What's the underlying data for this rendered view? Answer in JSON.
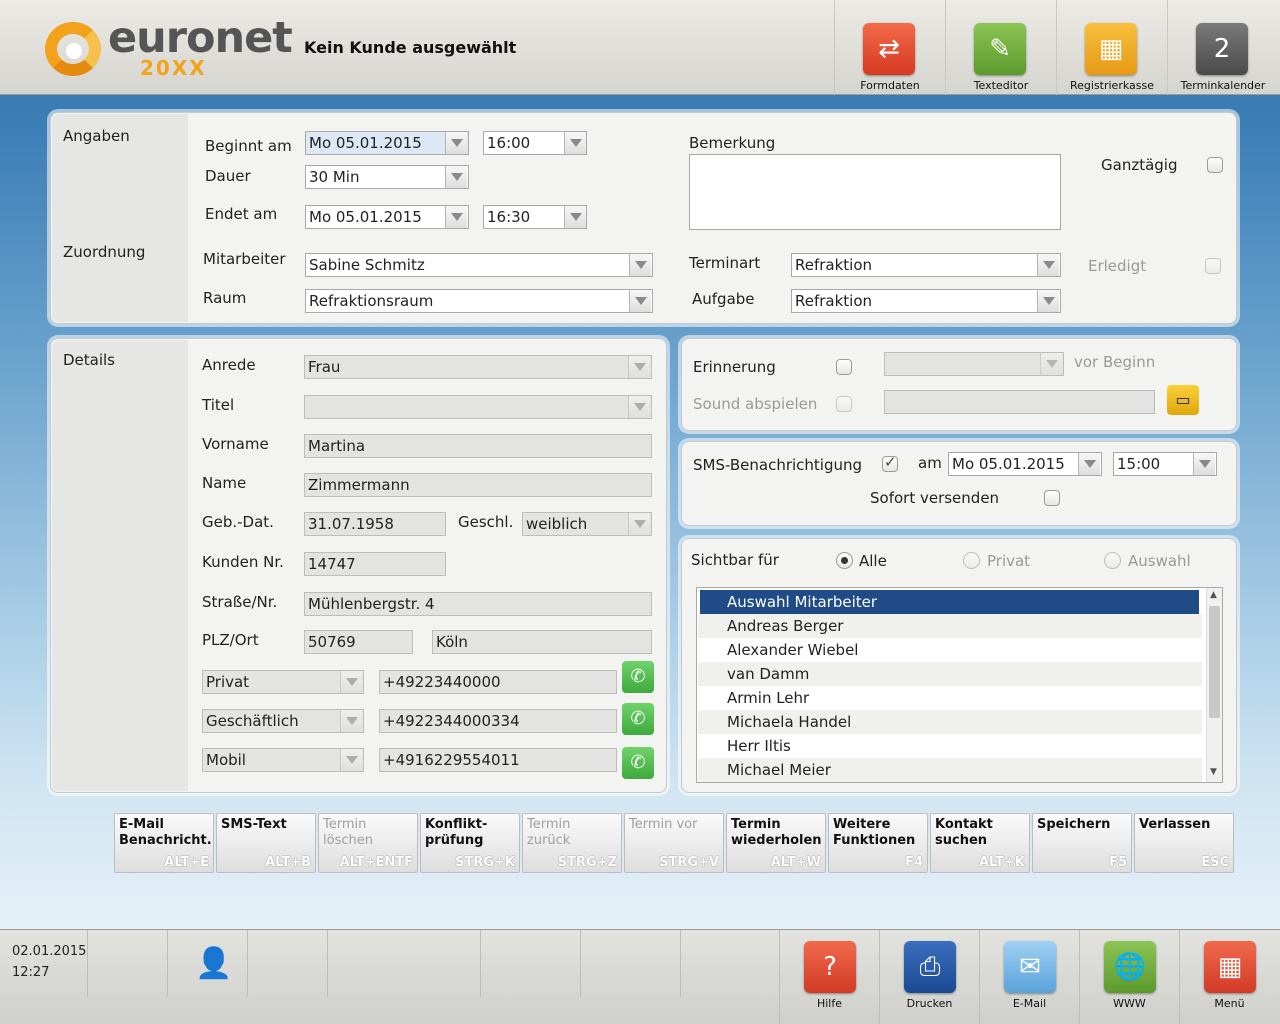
{
  "header": {
    "logo_text": "euronet",
    "logo_sub": "20XX",
    "customer": "Kein Kunde ausgewählt",
    "buttons": [
      {
        "label": "Formdaten",
        "icon": "form-data-icon",
        "color": "#e9432b"
      },
      {
        "label": "Texteditor",
        "icon": "pencil-icon",
        "color": "#6aa435"
      },
      {
        "label": "Registrierkasse",
        "icon": "cash-register-icon",
        "color": "#f0a418"
      },
      {
        "label": "Terminkalender",
        "icon": "calendar-icon",
        "color": "#5a5a5a"
      }
    ]
  },
  "angaben": {
    "section": "Angaben",
    "zuordnung": "Zuordnung",
    "beginnt_label": "Beginnt am",
    "beginnt_date": "Mo 05.01.2015",
    "beginnt_time": "16:00",
    "dauer_label": "Dauer",
    "dauer": "30 Min",
    "endet_label": "Endet am",
    "endet_date": "Mo 05.01.2015",
    "endet_time": "16:30",
    "bemerkung_label": "Bemerkung",
    "bemerkung": "",
    "ganztaegig_label": "Ganztägig",
    "ganztaegig": false,
    "mitarbeiter_label": "Mitarbeiter",
    "mitarbeiter": "Sabine Schmitz",
    "raum_label": "Raum",
    "raum": "Refraktionsraum",
    "terminart_label": "Terminart",
    "terminart": "Refraktion",
    "aufgabe_label": "Aufgabe",
    "aufgabe": "Refraktion",
    "erledigt_label": "Erledigt",
    "erledigt": false
  },
  "details": {
    "section": "Details",
    "anrede_label": "Anrede",
    "anrede": "Frau",
    "titel_label": "Titel",
    "titel": "",
    "vorname_label": "Vorname",
    "vorname": "Martina",
    "name_label": "Name",
    "name": "Zimmermann",
    "gebdat_label": "Geb.-Dat.",
    "gebdat": "31.07.1958",
    "geschl_label": "Geschl.",
    "geschl": "weiblich",
    "kundennr_label": "Kunden Nr.",
    "kundennr": "14747",
    "strasse_label": "Straße/Nr.",
    "strasse": "Mühlenbergstr. 4",
    "plz_label": "PLZ/Ort",
    "plz": "50769",
    "ort": "Köln",
    "phones": [
      {
        "type": "Privat",
        "number": "+49223440000"
      },
      {
        "type": "Geschäftlich",
        "number": "+4922344000334"
      },
      {
        "type": "Mobil",
        "number": "+4916229554011"
      }
    ]
  },
  "erinnerung": {
    "label": "Erinnerung",
    "checked": false,
    "select": "",
    "vor_beginn": "vor Beginn",
    "sound_label": "Sound abspielen",
    "sound": ""
  },
  "sms": {
    "label": "SMS-Benachrichtigung",
    "checked": true,
    "am": "am",
    "date": "Mo 05.01.2015",
    "time": "15:00",
    "sofort_label": "Sofort versenden",
    "sofort": false
  },
  "sichtbar": {
    "label": "Sichtbar für",
    "options": [
      "Alle",
      "Privat",
      "Auswahl"
    ],
    "selected": "Alle",
    "list": [
      "Auswahl Mitarbeiter",
      "Andreas Berger",
      "Alexander Wiebel",
      "van Damm",
      "Armin Lehr",
      "Michaela Handel",
      "Herr Iltis",
      "Michael Meier"
    ]
  },
  "actions": [
    {
      "label": "E-Mail\nBenachricht.",
      "key": "ALT+E",
      "enabled": true
    },
    {
      "label": "SMS-Text",
      "key": "ALT+B",
      "enabled": true
    },
    {
      "label": "Termin\nlöschen",
      "key": "ALT+ENTF",
      "enabled": false
    },
    {
      "label": "Konflikt-\nprüfung",
      "key": "STRG+K",
      "enabled": true
    },
    {
      "label": "Termin\nzurück",
      "key": "STRG+Z",
      "enabled": false
    },
    {
      "label": "Termin vor",
      "key": "STRG+V",
      "enabled": false
    },
    {
      "label": "Termin\nwiederholen",
      "key": "ALT+W",
      "enabled": true
    },
    {
      "label": "Weitere\nFunktionen",
      "key": "F4",
      "enabled": true
    },
    {
      "label": "Kontakt\nsuchen",
      "key": "ALT+K",
      "enabled": true
    },
    {
      "label": "Speichern",
      "key": "F5",
      "enabled": true
    },
    {
      "label": "Verlassen",
      "key": "ESC",
      "enabled": true
    }
  ],
  "footer": {
    "date": "02.01.2015",
    "time": "12:27",
    "buttons": [
      {
        "label": "Hilfe",
        "icon": "help-icon",
        "color": "#e03d2a"
      },
      {
        "label": "Drucken",
        "icon": "printer-icon",
        "color": "#1f4f9a"
      },
      {
        "label": "E-Mail",
        "icon": "mail-icon",
        "color": "#5fa6dc"
      },
      {
        "label": "WWW",
        "icon": "globe-icon",
        "color": "#6aa435"
      },
      {
        "label": "Menü",
        "icon": "menu-grid-icon",
        "color": "#e03d2a"
      }
    ]
  }
}
